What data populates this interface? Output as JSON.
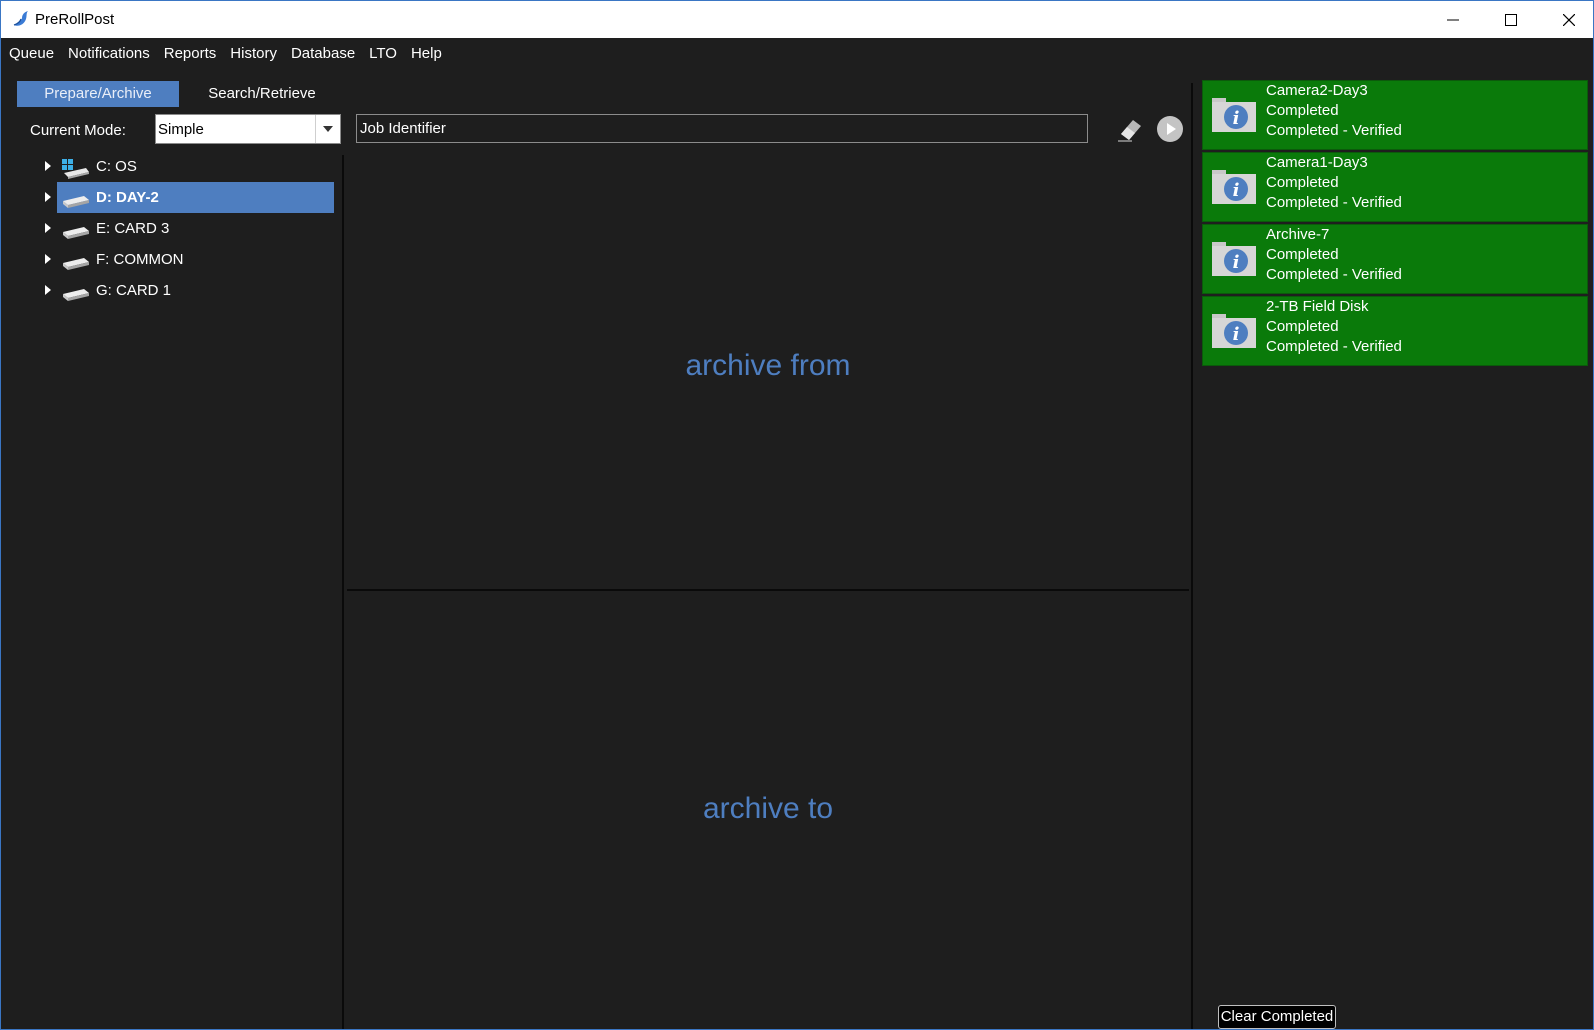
{
  "window": {
    "title": "PreRollPost"
  },
  "menu": [
    "Queue",
    "Notifications",
    "Reports",
    "History",
    "Database",
    "LTO",
    "Help"
  ],
  "tabs": {
    "prepare": "Prepare/Archive",
    "search": "Search/Retrieve"
  },
  "mode": {
    "label": "Current Mode:",
    "value": "Simple"
  },
  "job": {
    "placeholder": "Job Identifier"
  },
  "drives": [
    {
      "label": "C: OS",
      "icon": "os-drive-icon",
      "selected": false
    },
    {
      "label": "D: DAY-2",
      "icon": "drive-icon",
      "selected": true
    },
    {
      "label": "E: CARD 3",
      "icon": "drive-icon",
      "selected": false
    },
    {
      "label": "F: COMMON",
      "icon": "drive-icon",
      "selected": false
    },
    {
      "label": "G: CARD 1",
      "icon": "drive-icon",
      "selected": false
    }
  ],
  "panes": {
    "from": "archive from",
    "to": "archive to"
  },
  "queue": [
    {
      "name": "Camera2-Day3",
      "status": "Completed",
      "detail": "Completed - Verified"
    },
    {
      "name": "Camera1-Day3",
      "status": "Completed",
      "detail": "Completed - Verified"
    },
    {
      "name": "Archive-7",
      "status": "Completed",
      "detail": "Completed - Verified"
    },
    {
      "name": "2-TB Field Disk",
      "status": "Completed",
      "detail": "Completed - Verified"
    }
  ],
  "clear_button": "Clear Completed",
  "colors": {
    "accent": "#4e7ec0",
    "card_green": "#0a7a0a",
    "background": "#1e1e1e"
  }
}
